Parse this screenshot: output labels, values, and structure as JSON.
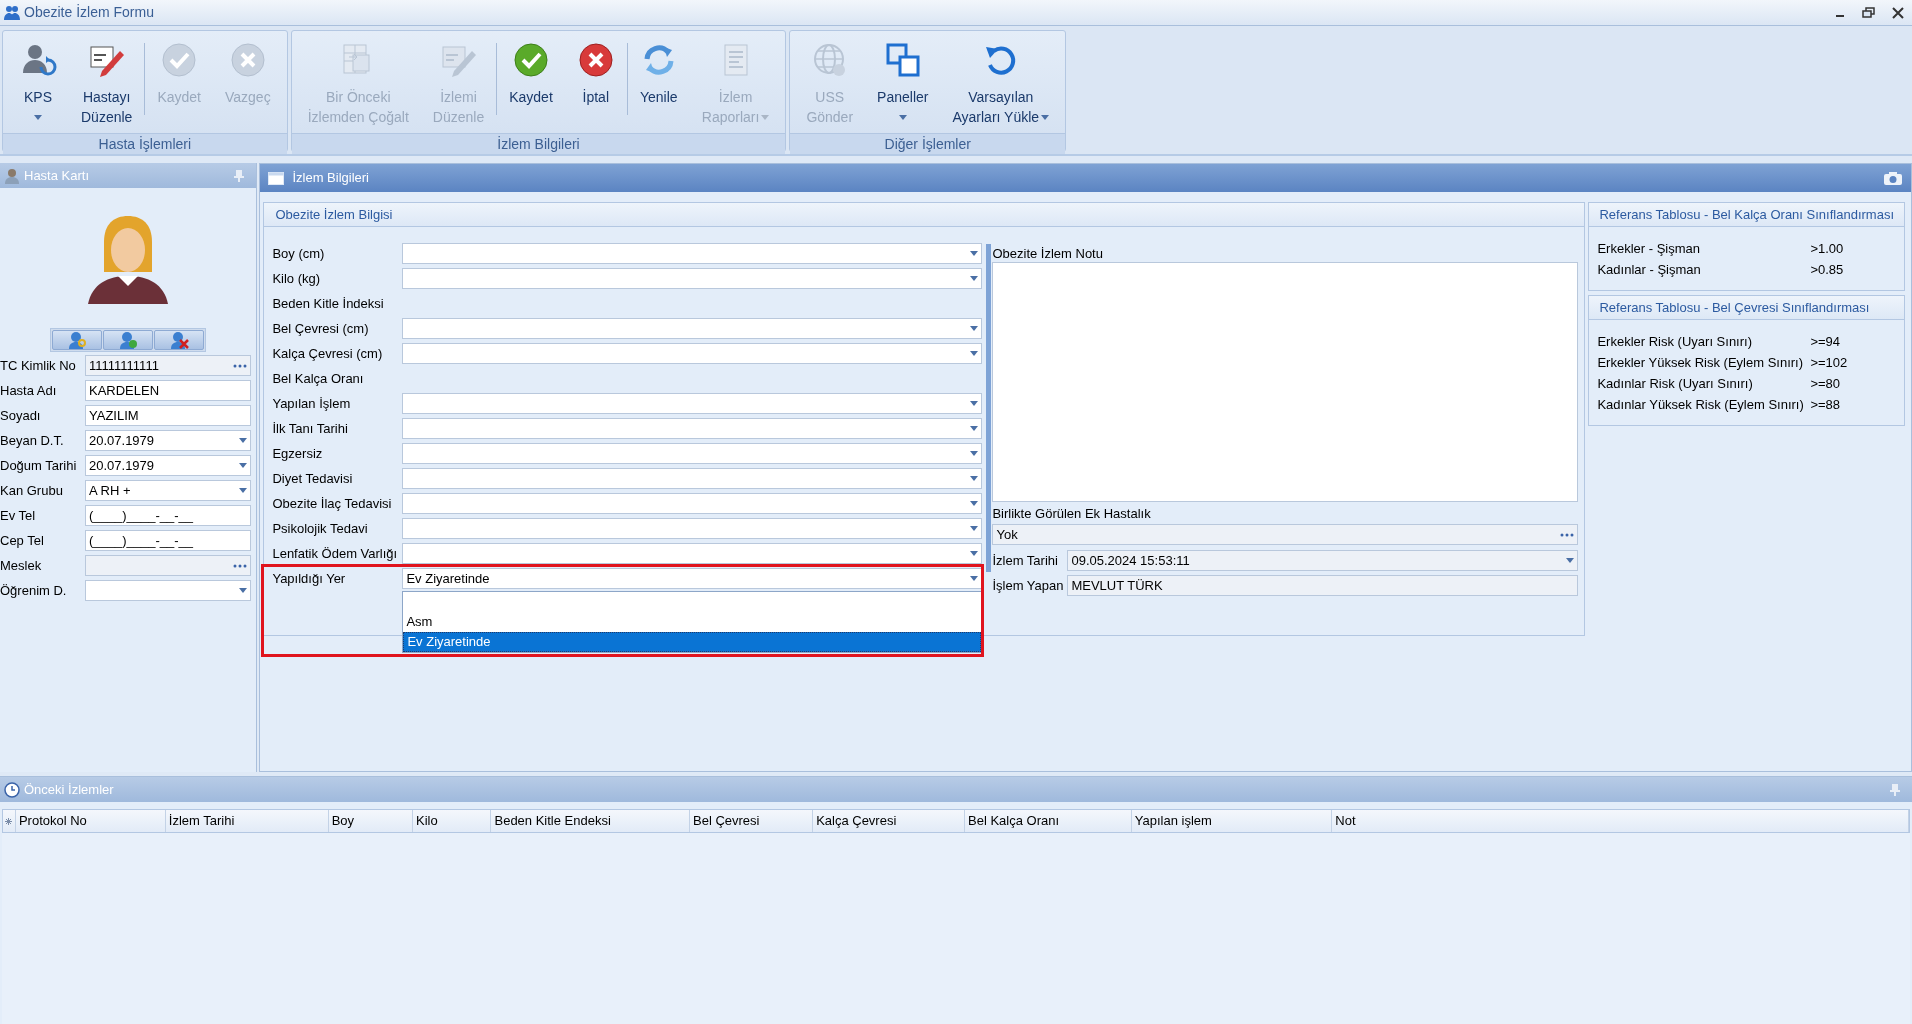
{
  "window": {
    "title": "Obezite İzlem Formu"
  },
  "ribbon": {
    "groups": [
      {
        "label": "Hasta İşlemleri",
        "buttons": [
          {
            "lines": [
              "KPS"
            ],
            "disabled": false,
            "caret": true,
            "separator": false
          },
          {
            "lines": [
              "Hastayı",
              "Düzenle"
            ],
            "disabled": false,
            "caret": false,
            "separator": true
          },
          {
            "lines": [
              "Kaydet"
            ],
            "disabled": true,
            "caret": false,
            "separator": false
          },
          {
            "lines": [
              "Vazgeç"
            ],
            "disabled": true,
            "caret": false,
            "separator": false
          }
        ]
      },
      {
        "label": "İzlem Bilgileri",
        "buttons": [
          {
            "lines": [
              "Bir Önceki",
              "İzlemden Çoğalt"
            ],
            "disabled": true,
            "caret": false,
            "separator": false
          },
          {
            "lines": [
              "İzlemi",
              "Düzenle"
            ],
            "disabled": true,
            "caret": false,
            "separator": true
          },
          {
            "lines": [
              "Kaydet"
            ],
            "disabled": false,
            "caret": false,
            "separator": false
          },
          {
            "lines": [
              "İptal"
            ],
            "disabled": false,
            "caret": false,
            "separator": true
          },
          {
            "lines": [
              "Yenile"
            ],
            "disabled": false,
            "caret": false,
            "separator": false
          },
          {
            "lines": [
              "İzlem",
              "Raporları"
            ],
            "disabled": true,
            "caret": true,
            "separator": false
          }
        ]
      },
      {
        "label": "Diğer İşlemler",
        "buttons": [
          {
            "lines": [
              "USS",
              "Gönder"
            ],
            "disabled": true,
            "caret": false,
            "separator": false
          },
          {
            "lines": [
              "Paneller"
            ],
            "disabled": false,
            "caret": true,
            "separator": false
          },
          {
            "lines": [
              "Varsayılan",
              "Ayarları Yükle"
            ],
            "disabled": false,
            "caret": true,
            "separator": false
          }
        ]
      }
    ]
  },
  "patient_card": {
    "title": "Hasta Kartı",
    "fields": [
      {
        "label": "TC Kimlik No",
        "value": "11111111111",
        "kind": "lookup",
        "readonly": true
      },
      {
        "label": "Hasta Adı",
        "value": "KARDELEN",
        "kind": "text",
        "readonly": false
      },
      {
        "label": "Soyadı",
        "value": "YAZILIM",
        "kind": "text",
        "readonly": false
      },
      {
        "label": "Beyan D.T.",
        "value": "20.07.1979",
        "kind": "combo",
        "readonly": false
      },
      {
        "label": "Doğum Tarihi",
        "value": "20.07.1979",
        "kind": "combo",
        "readonly": false
      },
      {
        "label": "Kan Grubu",
        "value": "A RH +",
        "kind": "combo",
        "readonly": false
      },
      {
        "label": "Ev Tel",
        "value": "(____)____-__-__",
        "kind": "text",
        "readonly": false
      },
      {
        "label": "Cep Tel",
        "value": "(____)____-__-__",
        "kind": "text",
        "readonly": false
      },
      {
        "label": "Meslek",
        "kind": "lookup",
        "readonly": true
      },
      {
        "label": "Öğrenim D.",
        "kind": "combo",
        "readonly": false
      }
    ]
  },
  "izlem": {
    "title": "İzlem Bilgileri",
    "group_title": "Obezite İzlem Bilgisi",
    "fields": [
      {
        "label": "Boy (cm)",
        "kind": "combo"
      },
      {
        "label": "Kilo (kg)",
        "kind": "combo"
      },
      {
        "label": "Beden Kitle İndeksi",
        "kind": "heading"
      },
      {
        "label": "Bel Çevresi (cm)",
        "kind": "combo"
      },
      {
        "label": "Kalça Çevresi (cm)",
        "kind": "combo"
      },
      {
        "label": "Bel Kalça Oranı",
        "kind": "heading"
      },
      {
        "label": "Yapılan İşlem",
        "kind": "combo"
      },
      {
        "label": "İlk Tanı Tarihi",
        "kind": "combo"
      },
      {
        "label": "Egzersiz",
        "kind": "combo"
      },
      {
        "label": "Diyet Tedavisi",
        "kind": "combo"
      },
      {
        "label": "Obezite İlaç Tedavisi",
        "kind": "combo"
      },
      {
        "label": "Psikolojik Tedavi",
        "kind": "combo"
      },
      {
        "label": "Lenfatik Ödem Varlığı",
        "kind": "combo"
      },
      {
        "label": "Yapıldığı Yer",
        "kind": "combo",
        "value": "Ev Ziyaretinde",
        "open": true,
        "options": [
          {
            "label": "Asm",
            "selected": false
          },
          {
            "label": "Ev Ziyaretinde",
            "selected": true
          }
        ]
      }
    ],
    "note_label": "Obezite İzlem Notu",
    "extra_disease": {
      "label": "Birlikte Görülen Ek Hastalık",
      "value": "Yok"
    },
    "date": {
      "label": "İzlem Tarihi",
      "value": "09.05.2024 15:53:11"
    },
    "operator": {
      "label": "İşlem Yapan",
      "value": "MEVLUT TÜRK"
    }
  },
  "reference_tables": [
    {
      "title": "Referans Tablosu - Bel Kalça Oranı Sınıflandırması",
      "rows": [
        {
          "name": "Erkekler - Şişman",
          "value": ">1.00"
        },
        {
          "name": "Kadınlar - Şişman",
          "value": ">0.85"
        }
      ]
    },
    {
      "title": "Referans Tablosu - Bel Çevresi Sınıflandırması",
      "rows": [
        {
          "name": "Erkekler Risk (Uyarı Sınırı)",
          "value": ">=94"
        },
        {
          "name": "Erkekler Yüksek Risk (Eylem Sınırı)",
          "value": ">=102"
        },
        {
          "name": "Kadınlar Risk (Uyarı Sınırı)",
          "value": ">=80"
        },
        {
          "name": "Kadınlar Yüksek Risk (Eylem Sınırı)",
          "value": ">=88"
        }
      ]
    }
  ],
  "previous": {
    "title": "Önceki İzlemler",
    "columns": [
      "Protokol No",
      "İzlem Tarihi",
      "Boy",
      "Kilo",
      "Beden Kitle Endeksi",
      "Bel Çevresi",
      "Kalça Çevresi",
      "Bel Kalça Oranı",
      "Yapılan işlem",
      "Not"
    ]
  }
}
